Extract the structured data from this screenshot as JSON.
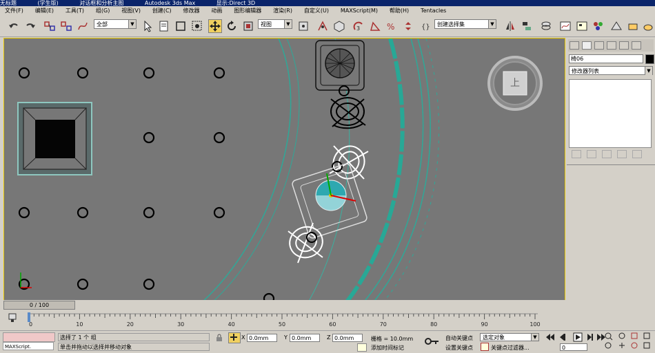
{
  "titlebar": {
    "segments": [
      "无标题",
      "(学生版)",
      "对话框和分析主图",
      "Autodesk 3ds Max",
      "显示:Direct 3D"
    ]
  },
  "menubar": {
    "items": [
      "文件(F)",
      "编辑(E)",
      "工具(T)",
      "组(G)",
      "视图(V)",
      "创建(C)",
      "修改器",
      "动画",
      "图形编辑器",
      "渲染(R)",
      "自定义(U)",
      "MAXScript(M)",
      "帮助(H)",
      "Tentacles"
    ]
  },
  "toolbar": {
    "selection_filter": "全部",
    "reference_coord": "视图",
    "named_selection": "创建选择集"
  },
  "viewport": {
    "viewcube_label": "上"
  },
  "command_panel": {
    "object_name": "椅06",
    "modifier_list": "修改器列表"
  },
  "timeline": {
    "frame_indicator": "0 / 100",
    "ticks": [
      "0",
      "10",
      "20",
      "30",
      "40",
      "50",
      "60",
      "70",
      "80",
      "90",
      "100"
    ]
  },
  "status": {
    "maxscript_label": "MAXScript.",
    "selection_message": "选择了 1 个 组",
    "prompt_message": "单击并拖动以选择并移动对象",
    "x_value": "0.0mm",
    "y_value": "0.0mm",
    "z_value": "0.0mm",
    "grid_label": "栅格 = 10.0mm",
    "autokey_label": "自动关键点",
    "set_key_label": "设置关键点",
    "key_mode_value": "选定对象",
    "key_filters_label": "关键点过滤器...",
    "add_time_tag": "添加时间标记",
    "frame_value": "0"
  },
  "colors": {
    "viewport_bg": "#777777",
    "active_border": "#e8c800",
    "teal_wall": "#22a89a",
    "ui_gray": "#d4d0c8"
  }
}
